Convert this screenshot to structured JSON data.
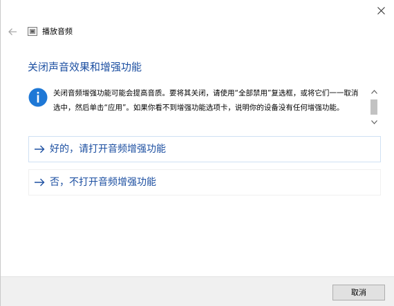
{
  "window": {
    "app_title": "播放音频",
    "close_icon": "close-icon",
    "back_icon": "back-arrow-icon"
  },
  "heading": "关闭声音效果和增强功能",
  "info": {
    "icon": "info-icon",
    "text": "关闭音频增强功能可能会提高音质。要将其关闭，请使用“全部禁用”复选框，或将它们一一取消选中，然后单击“应用”。如果你看不到增强功能选项卡，说明你的设备没有任何增强功能。"
  },
  "options": [
    {
      "label": "好的，请打开音频增强功能",
      "icon": "right-arrow-icon"
    },
    {
      "label": "否，不打开音频增强功能",
      "icon": "right-arrow-icon"
    }
  ],
  "footer": {
    "cancel_label": "取消"
  },
  "colors": {
    "accent": "#1c4fa1",
    "info_icon": "#1e78d6",
    "footer_bg": "#f0f0f0"
  }
}
